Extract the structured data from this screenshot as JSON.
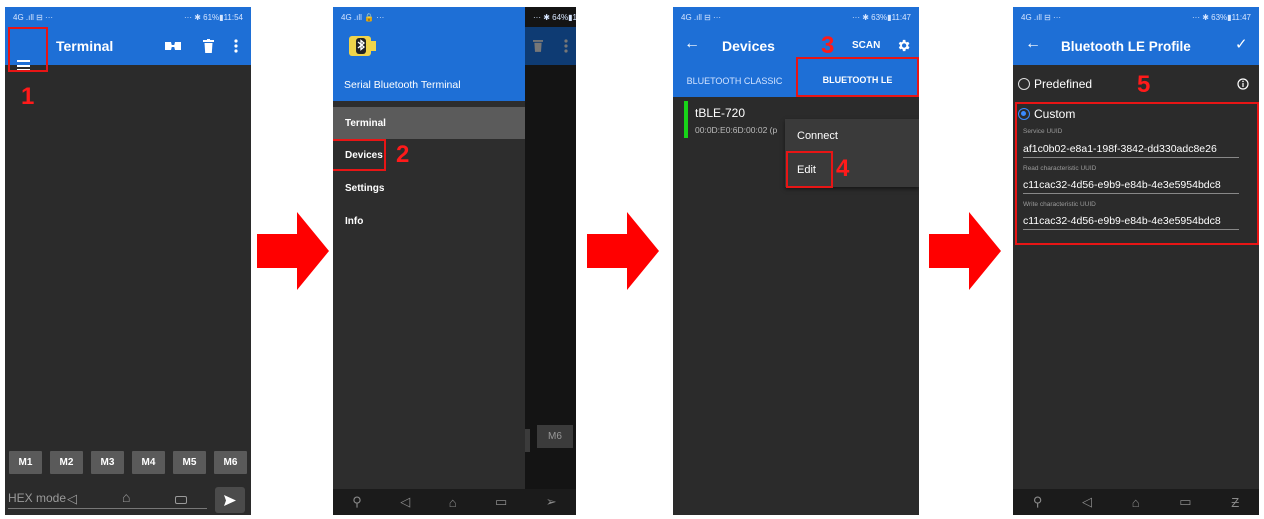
{
  "screens": [
    {
      "status_left": "4G .ıll ⊟ ···",
      "status_right": "··· ✱ 61%▮11:54",
      "title": "Terminal",
      "macro_buttons": [
        "M1",
        "M2",
        "M3",
        "M4",
        "M5",
        "M6"
      ],
      "input_placeholder": "HEX mode",
      "step": "1"
    },
    {
      "status_left": "4G .ıll 🔒 ···",
      "status_right": "··· ✱ 64%▮11:45",
      "app_name": "Serial Bluetooth Terminal",
      "menu": [
        "Terminal",
        "Devices",
        "Settings",
        "Info"
      ],
      "background_button": "M6",
      "step": "2"
    },
    {
      "status_left": "4G .ıll ⊟ ···",
      "status_right": "··· ✱ 63%▮11:47",
      "title": "Devices",
      "scan_label": "SCAN",
      "tabs": [
        "BLUETOOTH CLASSIC",
        "BLUETOOTH LE"
      ],
      "device_name": "tBLE-720",
      "device_address": "00:0D:E0:6D:00:02 (p",
      "context_menu": [
        "Connect",
        "Edit"
      ],
      "step_scan": "3",
      "step_edit": "4"
    },
    {
      "status_left": "4G .ıll ⊟ ···",
      "status_right": "··· ✱ 63%▮11:47",
      "title": "Bluetooth LE Profile",
      "predefined_label": "Predefined",
      "custom_label": "Custom",
      "service_uuid_label": "Service UUID",
      "service_uuid": "af1c0b02-e8a1-198f-3842-dd330adc8e26",
      "read_label": "Read characteristic UUID",
      "read_uuid": "c11cac32-4d56-e9b9-e84b-4e3e5954bdc8",
      "write_label": "Write characteristic UUID",
      "write_uuid": "c11cac32-4d56-e9b9-e84b-4e3e5954bdc8",
      "step": "5"
    }
  ],
  "colors": {
    "accent": "#1e6fd6",
    "background": "#2b2b2b",
    "highlight": "#e81515",
    "connected_indicator": "#18d418"
  },
  "icons": [
    "menu-icon",
    "connect-icon",
    "trash-icon",
    "more-icon",
    "back-icon",
    "gear-icon",
    "check-icon",
    "info-icon",
    "bluetooth-icon",
    "send-icon",
    "right-arrow-icon"
  ]
}
